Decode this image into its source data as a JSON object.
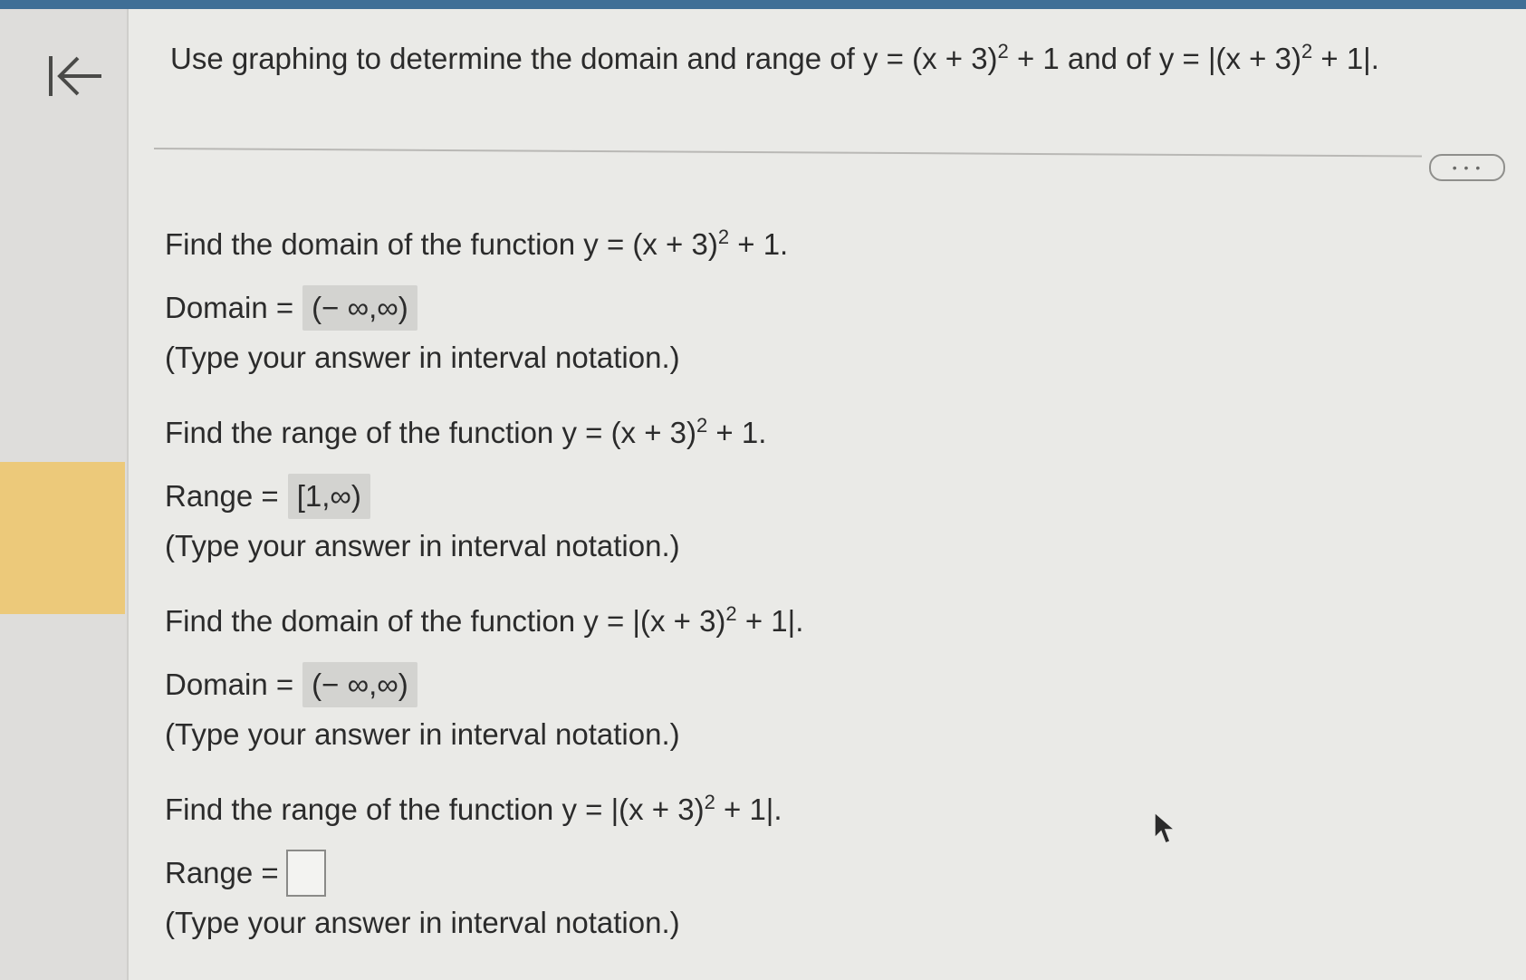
{
  "header": {
    "title_prefix": "Use graphing to determine the domain and range of y = (x + 3)",
    "title_exp1": "2",
    "title_middle": " + 1 and of y = |(x + 3)",
    "title_exp2": "2",
    "title_suffix": " + 1|."
  },
  "toolbar": {
    "more_label": "• • •"
  },
  "parts": [
    {
      "prompt_prefix": "Find the domain of the function y = (x + 3)",
      "exponent": "2",
      "prompt_suffix": " + 1.",
      "label": "Domain =",
      "value": "(− ∞,∞)",
      "hint": "(Type your answer in interval notation.)"
    },
    {
      "prompt_prefix": "Find the range of the function y = (x + 3)",
      "exponent": "2",
      "prompt_suffix": " + 1.",
      "label": "Range =",
      "value": "[1,∞)",
      "hint": "(Type your answer in interval notation.)"
    },
    {
      "prompt_prefix": "Find the domain of the function y = |(x + 3)",
      "exponent": "2",
      "prompt_suffix": " + 1|.",
      "label": "Domain =",
      "value": "(− ∞,∞)",
      "hint": "(Type your answer in interval notation.)"
    },
    {
      "prompt_prefix": "Find the range of the function y = |(x + 3)",
      "exponent": "2",
      "prompt_suffix": " + 1|.",
      "label": "Range =",
      "value": "",
      "hint": "(Type your answer in interval notation.)"
    }
  ]
}
